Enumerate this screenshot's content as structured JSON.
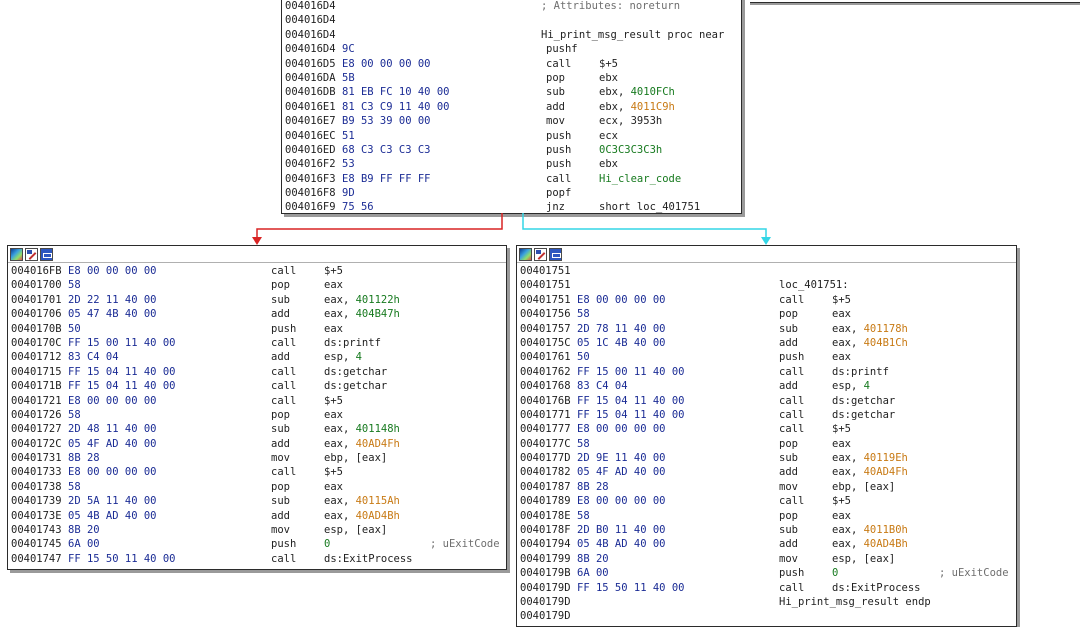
{
  "colors": {
    "edge_false": "#d92424",
    "edge_true": "#33d6e6",
    "green": "#177a1f",
    "orange": "#c87a14",
    "bytes": "#1b2c95"
  },
  "icons": [
    "graph-overview-icon",
    "edit-icon",
    "xref-icon"
  ],
  "blocks": [
    {
      "lines": [
        {
          "addr": "004016D4",
          "bytes": "",
          "mn": "",
          "ops": [
            {
              "t": "; Attributes: noreturn",
              "k": "cmt"
            }
          ],
          "cmt": ""
        },
        {
          "addr": "004016D4",
          "bytes": "",
          "mn": "",
          "ops": [],
          "cmt": ""
        },
        {
          "addr": "004016D4",
          "bytes": "",
          "mn": "",
          "ops": [
            {
              "t": "Hi_print_msg_result proc near",
              "k": ""
            }
          ],
          "cmt": ""
        },
        {
          "addr": "004016D4",
          "bytes": "9C",
          "mn": "pushf",
          "ops": [],
          "cmt": ""
        },
        {
          "addr": "004016D5",
          "bytes": "E8 00 00 00 00",
          "mn": "call",
          "ops": [
            {
              "t": "$+5",
              "k": ""
            }
          ],
          "cmt": ""
        },
        {
          "addr": "004016DA",
          "bytes": "5B",
          "mn": "pop",
          "ops": [
            {
              "t": "ebx",
              "k": ""
            }
          ],
          "cmt": ""
        },
        {
          "addr": "004016DB",
          "bytes": "81 EB FC 10 40 00",
          "mn": "sub",
          "ops": [
            {
              "t": "ebx, ",
              "k": ""
            },
            {
              "t": "4010FCh",
              "k": "grn"
            }
          ],
          "cmt": ""
        },
        {
          "addr": "004016E1",
          "bytes": "81 C3 C9 11 40 00",
          "mn": "add",
          "ops": [
            {
              "t": "ebx, ",
              "k": ""
            },
            {
              "t": "4011C9h",
              "k": "org"
            }
          ],
          "cmt": ""
        },
        {
          "addr": "004016E7",
          "bytes": "B9 53 39 00 00",
          "mn": "mov",
          "ops": [
            {
              "t": "ecx, 3953h",
              "k": ""
            }
          ],
          "cmt": ""
        },
        {
          "addr": "004016EC",
          "bytes": "51",
          "mn": "push",
          "ops": [
            {
              "t": "ecx",
              "k": ""
            }
          ],
          "cmt": ""
        },
        {
          "addr": "004016ED",
          "bytes": "68 C3 C3 C3 C3",
          "mn": "push",
          "ops": [
            {
              "t": "0C3C3C3C3h",
              "k": "grn"
            }
          ],
          "cmt": ""
        },
        {
          "addr": "004016F2",
          "bytes": "53",
          "mn": "push",
          "ops": [
            {
              "t": "ebx",
              "k": ""
            }
          ],
          "cmt": ""
        },
        {
          "addr": "004016F3",
          "bytes": "E8 B9 FF FF FF",
          "mn": "call",
          "ops": [
            {
              "t": "Hi_clear_code",
              "k": "grn"
            }
          ],
          "cmt": ""
        },
        {
          "addr": "004016F8",
          "bytes": "9D",
          "mn": "popf",
          "ops": [],
          "cmt": ""
        },
        {
          "addr": "004016F9",
          "bytes": "75 56",
          "mn": "jnz",
          "ops": [
            {
              "t": "short loc_401751",
              "k": ""
            }
          ],
          "cmt": ""
        }
      ]
    },
    {
      "lines": [
        {
          "addr": "004016FB",
          "bytes": "E8 00 00 00 00",
          "mn": "call",
          "ops": [
            {
              "t": "$+5",
              "k": ""
            }
          ],
          "cmt": ""
        },
        {
          "addr": "00401700",
          "bytes": "58",
          "mn": "pop",
          "ops": [
            {
              "t": "eax",
              "k": ""
            }
          ],
          "cmt": ""
        },
        {
          "addr": "00401701",
          "bytes": "2D 22 11 40 00",
          "mn": "sub",
          "ops": [
            {
              "t": "eax, ",
              "k": ""
            },
            {
              "t": "401122h",
              "k": "grn"
            }
          ],
          "cmt": ""
        },
        {
          "addr": "00401706",
          "bytes": "05 47 4B 40 00",
          "mn": "add",
          "ops": [
            {
              "t": "eax, ",
              "k": ""
            },
            {
              "t": "404B47h",
              "k": "grn"
            }
          ],
          "cmt": ""
        },
        {
          "addr": "0040170B",
          "bytes": "50",
          "mn": "push",
          "ops": [
            {
              "t": "eax",
              "k": ""
            }
          ],
          "cmt": ""
        },
        {
          "addr": "0040170C",
          "bytes": "FF 15 00 11 40 00",
          "mn": "call",
          "ops": [
            {
              "t": "ds:printf",
              "k": ""
            }
          ],
          "cmt": ""
        },
        {
          "addr": "00401712",
          "bytes": "83 C4 04",
          "mn": "add",
          "ops": [
            {
              "t": "esp, ",
              "k": ""
            },
            {
              "t": "4",
              "k": "grn"
            }
          ],
          "cmt": ""
        },
        {
          "addr": "00401715",
          "bytes": "FF 15 04 11 40 00",
          "mn": "call",
          "ops": [
            {
              "t": "ds:getchar",
              "k": ""
            }
          ],
          "cmt": ""
        },
        {
          "addr": "0040171B",
          "bytes": "FF 15 04 11 40 00",
          "mn": "call",
          "ops": [
            {
              "t": "ds:getchar",
              "k": ""
            }
          ],
          "cmt": ""
        },
        {
          "addr": "00401721",
          "bytes": "E8 00 00 00 00",
          "mn": "call",
          "ops": [
            {
              "t": "$+5",
              "k": ""
            }
          ],
          "cmt": ""
        },
        {
          "addr": "00401726",
          "bytes": "58",
          "mn": "pop",
          "ops": [
            {
              "t": "eax",
              "k": ""
            }
          ],
          "cmt": ""
        },
        {
          "addr": "00401727",
          "bytes": "2D 48 11 40 00",
          "mn": "sub",
          "ops": [
            {
              "t": "eax, ",
              "k": ""
            },
            {
              "t": "401148h",
              "k": "grn"
            }
          ],
          "cmt": ""
        },
        {
          "addr": "0040172C",
          "bytes": "05 4F AD 40 00",
          "mn": "add",
          "ops": [
            {
              "t": "eax, ",
              "k": ""
            },
            {
              "t": "40AD4Fh",
              "k": "org"
            }
          ],
          "cmt": ""
        },
        {
          "addr": "00401731",
          "bytes": "8B 28",
          "mn": "mov",
          "ops": [
            {
              "t": "ebp, [eax]",
              "k": ""
            }
          ],
          "cmt": ""
        },
        {
          "addr": "00401733",
          "bytes": "E8 00 00 00 00",
          "mn": "call",
          "ops": [
            {
              "t": "$+5",
              "k": ""
            }
          ],
          "cmt": ""
        },
        {
          "addr": "00401738",
          "bytes": "58",
          "mn": "pop",
          "ops": [
            {
              "t": "eax",
              "k": ""
            }
          ],
          "cmt": ""
        },
        {
          "addr": "00401739",
          "bytes": "2D 5A 11 40 00",
          "mn": "sub",
          "ops": [
            {
              "t": "eax, ",
              "k": ""
            },
            {
              "t": "40115Ah",
              "k": "org"
            }
          ],
          "cmt": ""
        },
        {
          "addr": "0040173E",
          "bytes": "05 4B AD 40 00",
          "mn": "add",
          "ops": [
            {
              "t": "eax, ",
              "k": ""
            },
            {
              "t": "40AD4Bh",
              "k": "org"
            }
          ],
          "cmt": ""
        },
        {
          "addr": "00401743",
          "bytes": "8B 20",
          "mn": "mov",
          "ops": [
            {
              "t": "esp, [eax]",
              "k": ""
            }
          ],
          "cmt": ""
        },
        {
          "addr": "00401745",
          "bytes": "6A 00",
          "mn": "push",
          "ops": [
            {
              "t": "0",
              "k": "grn"
            }
          ],
          "cmt": "; uExitCode"
        },
        {
          "addr": "00401747",
          "bytes": "FF 15 50 11 40 00",
          "mn": "call",
          "ops": [
            {
              "t": "ds:ExitProcess",
              "k": ""
            }
          ],
          "cmt": ""
        }
      ]
    },
    {
      "lines": [
        {
          "addr": "00401751",
          "bytes": "",
          "mn": "",
          "ops": [],
          "cmt": ""
        },
        {
          "addr": "00401751",
          "bytes": "",
          "mn": "",
          "ops": [
            {
              "t": "loc_401751:",
              "k": ""
            }
          ],
          "cmt": ""
        },
        {
          "addr": "00401751",
          "bytes": "E8 00 00 00 00",
          "mn": "call",
          "ops": [
            {
              "t": "$+5",
              "k": ""
            }
          ],
          "cmt": ""
        },
        {
          "addr": "00401756",
          "bytes": "58",
          "mn": "pop",
          "ops": [
            {
              "t": "eax",
              "k": ""
            }
          ],
          "cmt": ""
        },
        {
          "addr": "00401757",
          "bytes": "2D 78 11 40 00",
          "mn": "sub",
          "ops": [
            {
              "t": "eax, ",
              "k": ""
            },
            {
              "t": "401178h",
              "k": "org"
            }
          ],
          "cmt": ""
        },
        {
          "addr": "0040175C",
          "bytes": "05 1C 4B 40 00",
          "mn": "add",
          "ops": [
            {
              "t": "eax, ",
              "k": ""
            },
            {
              "t": "404B1Ch",
              "k": "org"
            }
          ],
          "cmt": ""
        },
        {
          "addr": "00401761",
          "bytes": "50",
          "mn": "push",
          "ops": [
            {
              "t": "eax",
              "k": ""
            }
          ],
          "cmt": ""
        },
        {
          "addr": "00401762",
          "bytes": "FF 15 00 11 40 00",
          "mn": "call",
          "ops": [
            {
              "t": "ds:printf",
              "k": ""
            }
          ],
          "cmt": ""
        },
        {
          "addr": "00401768",
          "bytes": "83 C4 04",
          "mn": "add",
          "ops": [
            {
              "t": "esp, ",
              "k": ""
            },
            {
              "t": "4",
              "k": "grn"
            }
          ],
          "cmt": ""
        },
        {
          "addr": "0040176B",
          "bytes": "FF 15 04 11 40 00",
          "mn": "call",
          "ops": [
            {
              "t": "ds:getchar",
              "k": ""
            }
          ],
          "cmt": ""
        },
        {
          "addr": "00401771",
          "bytes": "FF 15 04 11 40 00",
          "mn": "call",
          "ops": [
            {
              "t": "ds:getchar",
              "k": ""
            }
          ],
          "cmt": ""
        },
        {
          "addr": "00401777",
          "bytes": "E8 00 00 00 00",
          "mn": "call",
          "ops": [
            {
              "t": "$+5",
              "k": ""
            }
          ],
          "cmt": ""
        },
        {
          "addr": "0040177C",
          "bytes": "58",
          "mn": "pop",
          "ops": [
            {
              "t": "eax",
              "k": ""
            }
          ],
          "cmt": ""
        },
        {
          "addr": "0040177D",
          "bytes": "2D 9E 11 40 00",
          "mn": "sub",
          "ops": [
            {
              "t": "eax, ",
              "k": ""
            },
            {
              "t": "40119Eh",
              "k": "org"
            }
          ],
          "cmt": ""
        },
        {
          "addr": "00401782",
          "bytes": "05 4F AD 40 00",
          "mn": "add",
          "ops": [
            {
              "t": "eax, ",
              "k": ""
            },
            {
              "t": "40AD4Fh",
              "k": "org"
            }
          ],
          "cmt": ""
        },
        {
          "addr": "00401787",
          "bytes": "8B 28",
          "mn": "mov",
          "ops": [
            {
              "t": "ebp, [eax]",
              "k": ""
            }
          ],
          "cmt": ""
        },
        {
          "addr": "00401789",
          "bytes": "E8 00 00 00 00",
          "mn": "call",
          "ops": [
            {
              "t": "$+5",
              "k": ""
            }
          ],
          "cmt": ""
        },
        {
          "addr": "0040178E",
          "bytes": "58",
          "mn": "pop",
          "ops": [
            {
              "t": "eax",
              "k": ""
            }
          ],
          "cmt": ""
        },
        {
          "addr": "0040178F",
          "bytes": "2D B0 11 40 00",
          "mn": "sub",
          "ops": [
            {
              "t": "eax, ",
              "k": ""
            },
            {
              "t": "4011B0h",
              "k": "org"
            }
          ],
          "cmt": ""
        },
        {
          "addr": "00401794",
          "bytes": "05 4B AD 40 00",
          "mn": "add",
          "ops": [
            {
              "t": "eax, ",
              "k": ""
            },
            {
              "t": "40AD4Bh",
              "k": "org"
            }
          ],
          "cmt": ""
        },
        {
          "addr": "00401799",
          "bytes": "8B 20",
          "mn": "mov",
          "ops": [
            {
              "t": "esp, [eax]",
              "k": ""
            }
          ],
          "cmt": ""
        },
        {
          "addr": "0040179B",
          "bytes": "6A 00",
          "mn": "push",
          "ops": [
            {
              "t": "0",
              "k": "grn"
            }
          ],
          "cmt": "; uExitCode"
        },
        {
          "addr": "0040179D",
          "bytes": "FF 15 50 11 40 00",
          "mn": "call",
          "ops": [
            {
              "t": "ds:ExitProcess",
              "k": ""
            }
          ],
          "cmt": ""
        },
        {
          "addr": "0040179D",
          "bytes": "",
          "mn": "",
          "ops": [
            {
              "t": "Hi_print_msg_result endp",
              "k": ""
            }
          ],
          "cmt": ""
        },
        {
          "addr": "0040179D",
          "bytes": "",
          "mn": "",
          "ops": [],
          "cmt": ""
        }
      ]
    }
  ]
}
